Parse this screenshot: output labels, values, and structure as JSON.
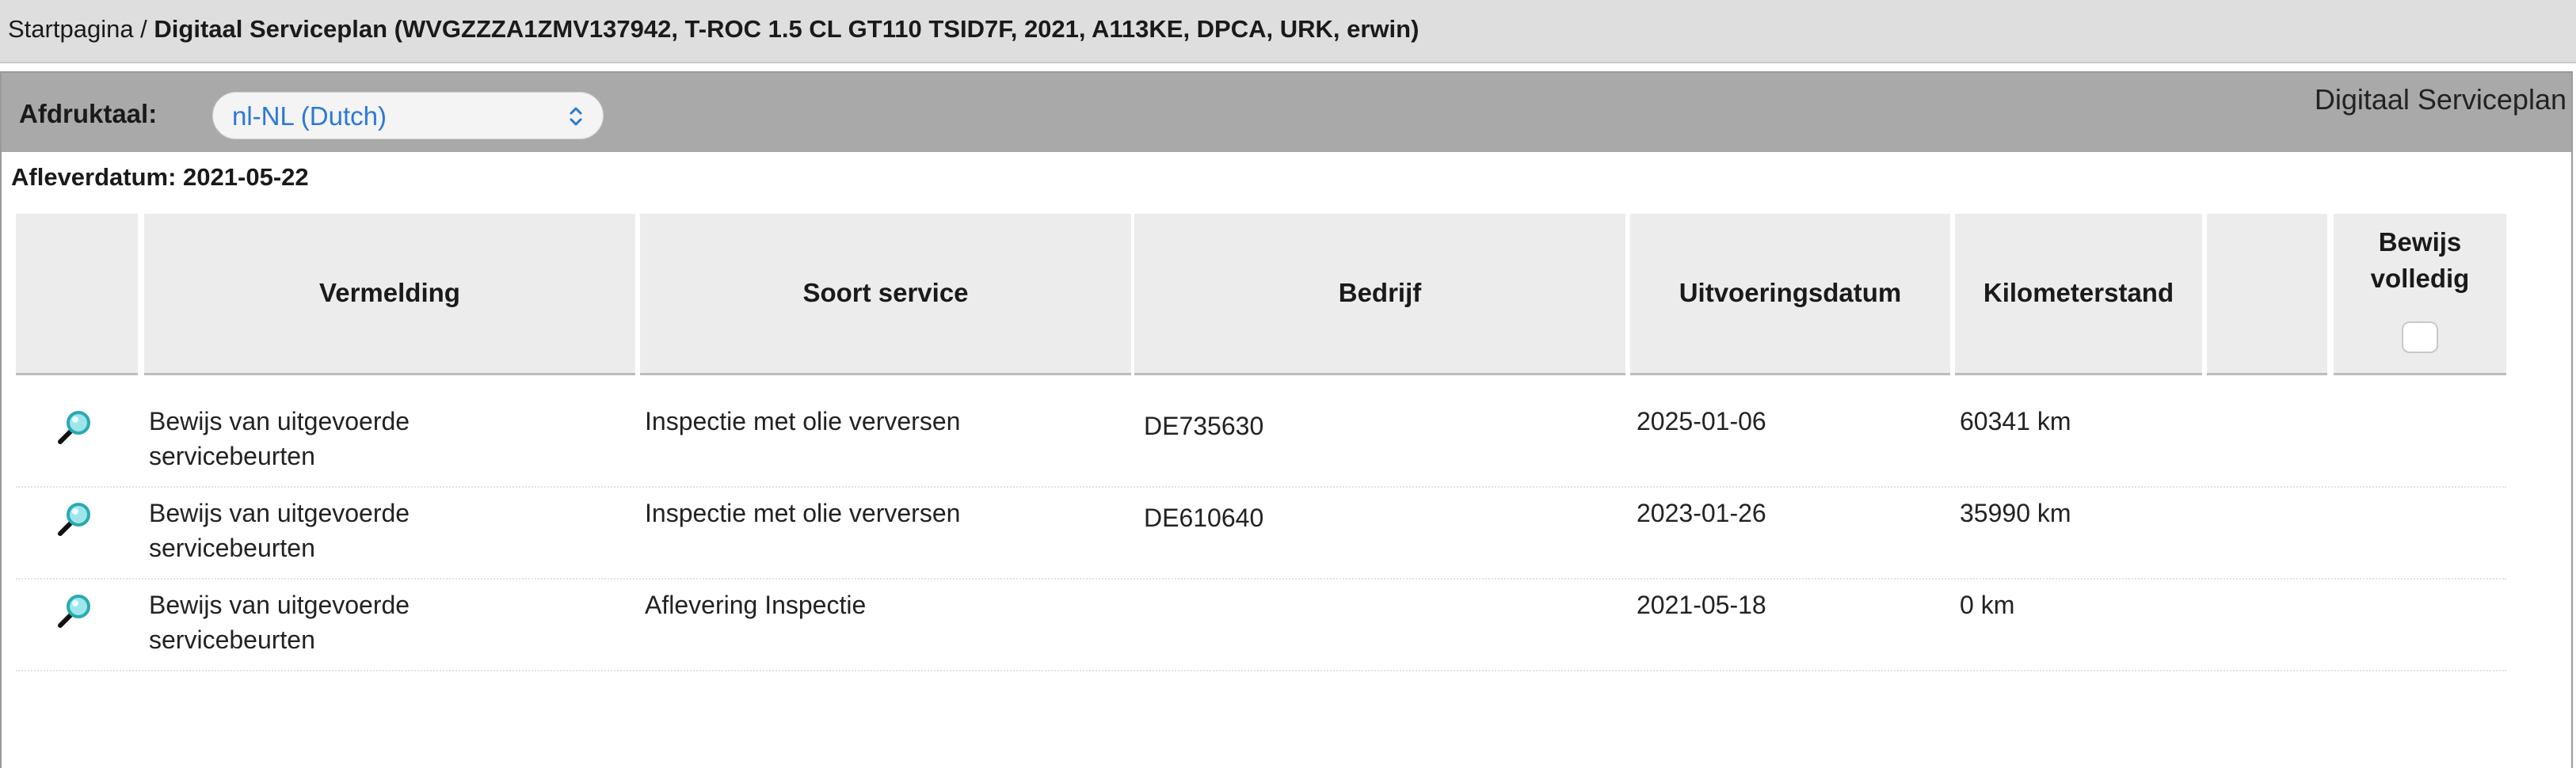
{
  "breadcrumb": {
    "home": "Startpagina",
    "separator": " / ",
    "current": "Digitaal Serviceplan (WVGZZZA1ZMV137942, T-ROC 1.5 CL GT110 TSID7F, 2021, A113KE, DPCA, URK, erwin)"
  },
  "panel": {
    "language_label": "Afdruktaal:",
    "language_value": "nl-NL (Dutch)",
    "title": "Digitaal Serviceplan",
    "delivery_date": "Afleverdatum: 2021-05-22"
  },
  "table": {
    "headers": {
      "entry": "Vermelding",
      "service_type": "Soort service",
      "company": "Bedrijf",
      "date": "Uitvoeringsdatum",
      "mileage": "Kilometerstand",
      "proof_line1": "Bewijs",
      "proof_line2": "volledig"
    },
    "rows": [
      {
        "entry_line1": "Bewijs van uitgevoerde",
        "entry_line2": "servicebeurten",
        "service_type": "Inspectie met olie verversen",
        "company": "DE735630",
        "date": "2025-01-06",
        "mileage": "60341 km"
      },
      {
        "entry_line1": "Bewijs van uitgevoerde",
        "entry_line2": "servicebeurten",
        "service_type": "Inspectie met olie verversen",
        "company": "DE610640",
        "date": "2023-01-26",
        "mileage": "35990 km"
      },
      {
        "entry_line1": "Bewijs van uitgevoerde",
        "entry_line2": "servicebeurten",
        "service_type": "Aflevering Inspectie",
        "company": "",
        "date": "2021-05-18",
        "mileage": "0 km"
      }
    ]
  },
  "icons": {
    "view": "magnifier-icon",
    "select_chevron": "updown-chevron-icon"
  },
  "colors": {
    "topbar": "#dedede",
    "panel_header": "#a9a9a9",
    "table_header": "#ececec",
    "link_blue": "#2b78d8",
    "magnifier_lens": "#3fc3c9"
  }
}
